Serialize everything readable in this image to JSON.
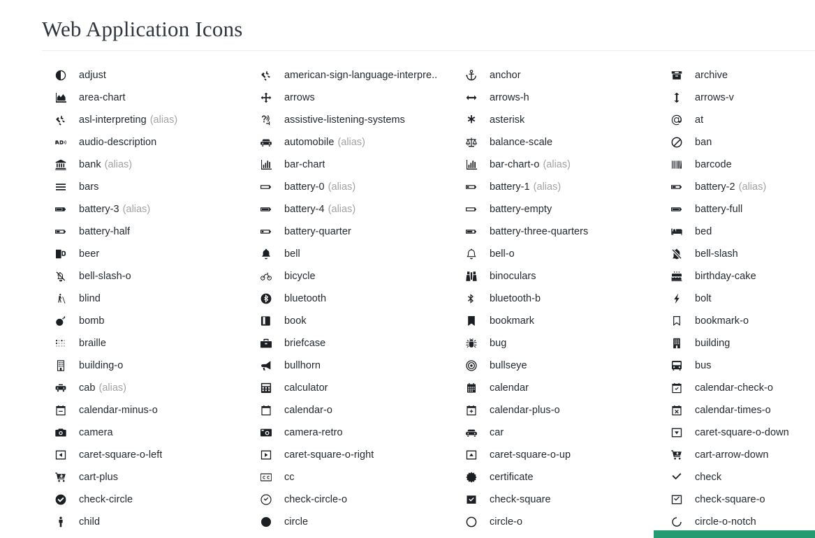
{
  "page": {
    "title": "Web Application Icons",
    "alias_suffix": "(alias)",
    "accent_color": "#249b70",
    "text_color": "#24292e",
    "alias_color": "#a3a3a3"
  },
  "columns": [
    {
      "items": [
        {
          "icon": "adjust-icon",
          "label": "adjust",
          "alias": false
        },
        {
          "icon": "area-chart-icon",
          "label": "area-chart",
          "alias": false
        },
        {
          "icon": "asl-interpreting-icon",
          "label": "asl-interpreting",
          "alias": true
        },
        {
          "icon": "audio-description-icon",
          "label": "audio-description",
          "alias": false
        },
        {
          "icon": "bank-icon",
          "label": "bank",
          "alias": true
        },
        {
          "icon": "bars-icon",
          "label": "bars",
          "alias": false
        },
        {
          "icon": "battery-3-icon",
          "label": "battery-3",
          "alias": true
        },
        {
          "icon": "battery-half-icon",
          "label": "battery-half",
          "alias": false
        },
        {
          "icon": "beer-icon",
          "label": "beer",
          "alias": false
        },
        {
          "icon": "bell-slash-o-icon",
          "label": "bell-slash-o",
          "alias": false
        },
        {
          "icon": "blind-icon",
          "label": "blind",
          "alias": false
        },
        {
          "icon": "bomb-icon",
          "label": "bomb",
          "alias": false
        },
        {
          "icon": "braille-icon",
          "label": "braille",
          "alias": false
        },
        {
          "icon": "building-o-icon",
          "label": "building-o",
          "alias": false
        },
        {
          "icon": "cab-icon",
          "label": "cab",
          "alias": true
        },
        {
          "icon": "calendar-minus-o-icon",
          "label": "calendar-minus-o",
          "alias": false
        },
        {
          "icon": "camera-icon",
          "label": "camera",
          "alias": false
        },
        {
          "icon": "caret-square-o-left-icon",
          "label": "caret-square-o-left",
          "alias": false
        },
        {
          "icon": "cart-plus-icon",
          "label": "cart-plus",
          "alias": false
        },
        {
          "icon": "check-circle-icon",
          "label": "check-circle",
          "alias": false
        },
        {
          "icon": "child-icon",
          "label": "child",
          "alias": false
        }
      ]
    },
    {
      "items": [
        {
          "icon": "american-sign-language-interpreting-icon",
          "label": "american-sign-language-interpre..",
          "alias": false
        },
        {
          "icon": "arrows-icon",
          "label": "arrows",
          "alias": false
        },
        {
          "icon": "assistive-listening-systems-icon",
          "label": "assistive-listening-systems",
          "alias": false
        },
        {
          "icon": "automobile-icon",
          "label": "automobile",
          "alias": true
        },
        {
          "icon": "bar-chart-icon",
          "label": "bar-chart",
          "alias": false
        },
        {
          "icon": "battery-0-icon",
          "label": "battery-0",
          "alias": true
        },
        {
          "icon": "battery-4-icon",
          "label": "battery-4",
          "alias": true
        },
        {
          "icon": "battery-quarter-icon",
          "label": "battery-quarter",
          "alias": false
        },
        {
          "icon": "bell-icon",
          "label": "bell",
          "alias": false
        },
        {
          "icon": "bicycle-icon",
          "label": "bicycle",
          "alias": false
        },
        {
          "icon": "bluetooth-icon",
          "label": "bluetooth",
          "alias": false
        },
        {
          "icon": "book-icon",
          "label": "book",
          "alias": false
        },
        {
          "icon": "briefcase-icon",
          "label": "briefcase",
          "alias": false
        },
        {
          "icon": "bullhorn-icon",
          "label": "bullhorn",
          "alias": false
        },
        {
          "icon": "calculator-icon",
          "label": "calculator",
          "alias": false
        },
        {
          "icon": "calendar-o-icon",
          "label": "calendar-o",
          "alias": false
        },
        {
          "icon": "camera-retro-icon",
          "label": "camera-retro",
          "alias": false
        },
        {
          "icon": "caret-square-o-right-icon",
          "label": "caret-square-o-right",
          "alias": false
        },
        {
          "icon": "cc-icon",
          "label": "cc",
          "alias": false
        },
        {
          "icon": "check-circle-o-icon",
          "label": "check-circle-o",
          "alias": false
        },
        {
          "icon": "circle-icon",
          "label": "circle",
          "alias": false
        }
      ]
    },
    {
      "items": [
        {
          "icon": "anchor-icon",
          "label": "anchor",
          "alias": false
        },
        {
          "icon": "arrows-h-icon",
          "label": "arrows-h",
          "alias": false
        },
        {
          "icon": "asterisk-icon",
          "label": "asterisk",
          "alias": false
        },
        {
          "icon": "balance-scale-icon",
          "label": "balance-scale",
          "alias": false
        },
        {
          "icon": "bar-chart-o-icon",
          "label": "bar-chart-o",
          "alias": true
        },
        {
          "icon": "battery-1-icon",
          "label": "battery-1",
          "alias": true
        },
        {
          "icon": "battery-empty-icon",
          "label": "battery-empty",
          "alias": false
        },
        {
          "icon": "battery-three-quarters-icon",
          "label": "battery-three-quarters",
          "alias": false
        },
        {
          "icon": "bell-o-icon",
          "label": "bell-o",
          "alias": false
        },
        {
          "icon": "binoculars-icon",
          "label": "binoculars",
          "alias": false
        },
        {
          "icon": "bluetooth-b-icon",
          "label": "bluetooth-b",
          "alias": false
        },
        {
          "icon": "bookmark-icon",
          "label": "bookmark",
          "alias": false
        },
        {
          "icon": "bug-icon",
          "label": "bug",
          "alias": false
        },
        {
          "icon": "bullseye-icon",
          "label": "bullseye",
          "alias": false
        },
        {
          "icon": "calendar-icon",
          "label": "calendar",
          "alias": false
        },
        {
          "icon": "calendar-plus-o-icon",
          "label": "calendar-plus-o",
          "alias": false
        },
        {
          "icon": "car-icon",
          "label": "car",
          "alias": false
        },
        {
          "icon": "caret-square-o-up-icon",
          "label": "caret-square-o-up",
          "alias": false
        },
        {
          "icon": "certificate-icon",
          "label": "certificate",
          "alias": false
        },
        {
          "icon": "check-square-icon",
          "label": "check-square",
          "alias": false
        },
        {
          "icon": "circle-o-icon",
          "label": "circle-o",
          "alias": false
        }
      ]
    },
    {
      "items": [
        {
          "icon": "archive-icon",
          "label": "archive",
          "alias": false
        },
        {
          "icon": "arrows-v-icon",
          "label": "arrows-v",
          "alias": false
        },
        {
          "icon": "at-icon",
          "label": "at",
          "alias": false
        },
        {
          "icon": "ban-icon",
          "label": "ban",
          "alias": false
        },
        {
          "icon": "barcode-icon",
          "label": "barcode",
          "alias": false
        },
        {
          "icon": "battery-2-icon",
          "label": "battery-2",
          "alias": true
        },
        {
          "icon": "battery-full-icon",
          "label": "battery-full",
          "alias": false
        },
        {
          "icon": "bed-icon",
          "label": "bed",
          "alias": false
        },
        {
          "icon": "bell-slash-icon",
          "label": "bell-slash",
          "alias": false
        },
        {
          "icon": "birthday-cake-icon",
          "label": "birthday-cake",
          "alias": false
        },
        {
          "icon": "bolt-icon",
          "label": "bolt",
          "alias": false
        },
        {
          "icon": "bookmark-o-icon",
          "label": "bookmark-o",
          "alias": false
        },
        {
          "icon": "building-icon",
          "label": "building",
          "alias": false
        },
        {
          "icon": "bus-icon",
          "label": "bus",
          "alias": false
        },
        {
          "icon": "calendar-check-o-icon",
          "label": "calendar-check-o",
          "alias": false
        },
        {
          "icon": "calendar-times-o-icon",
          "label": "calendar-times-o",
          "alias": false
        },
        {
          "icon": "caret-square-o-down-icon",
          "label": "caret-square-o-down",
          "alias": false
        },
        {
          "icon": "cart-arrow-down-icon",
          "label": "cart-arrow-down",
          "alias": false
        },
        {
          "icon": "check-icon",
          "label": "check",
          "alias": false
        },
        {
          "icon": "check-square-o-icon",
          "label": "check-square-o",
          "alias": false
        },
        {
          "icon": "circle-o-notch-icon",
          "label": "circle-o-notch",
          "alias": false
        }
      ]
    }
  ]
}
